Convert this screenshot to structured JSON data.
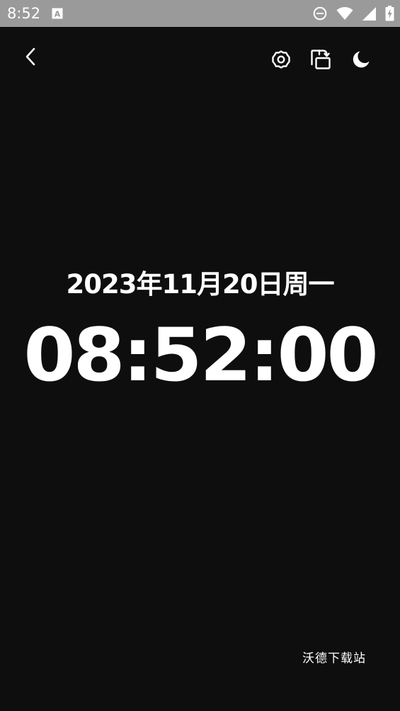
{
  "status_bar": {
    "time": "8:52",
    "app_icon": "text-a-icon",
    "icons": [
      "dnd-icon",
      "wifi-icon",
      "cellular-signal-icon",
      "battery-charging-icon"
    ]
  },
  "toolbar": {
    "back_icon": "chevron-left-icon",
    "settings_icon": "gear-icon",
    "rotate_icon": "screen-rotate-icon",
    "night_icon": "moon-icon"
  },
  "clock": {
    "date": "2023年11月20日周一",
    "time": "08:52:00"
  },
  "watermark": "沃德下载站",
  "colors": {
    "background": "#0e0e0e",
    "status_bar": "#9a9a9a",
    "text": "#ffffff"
  }
}
